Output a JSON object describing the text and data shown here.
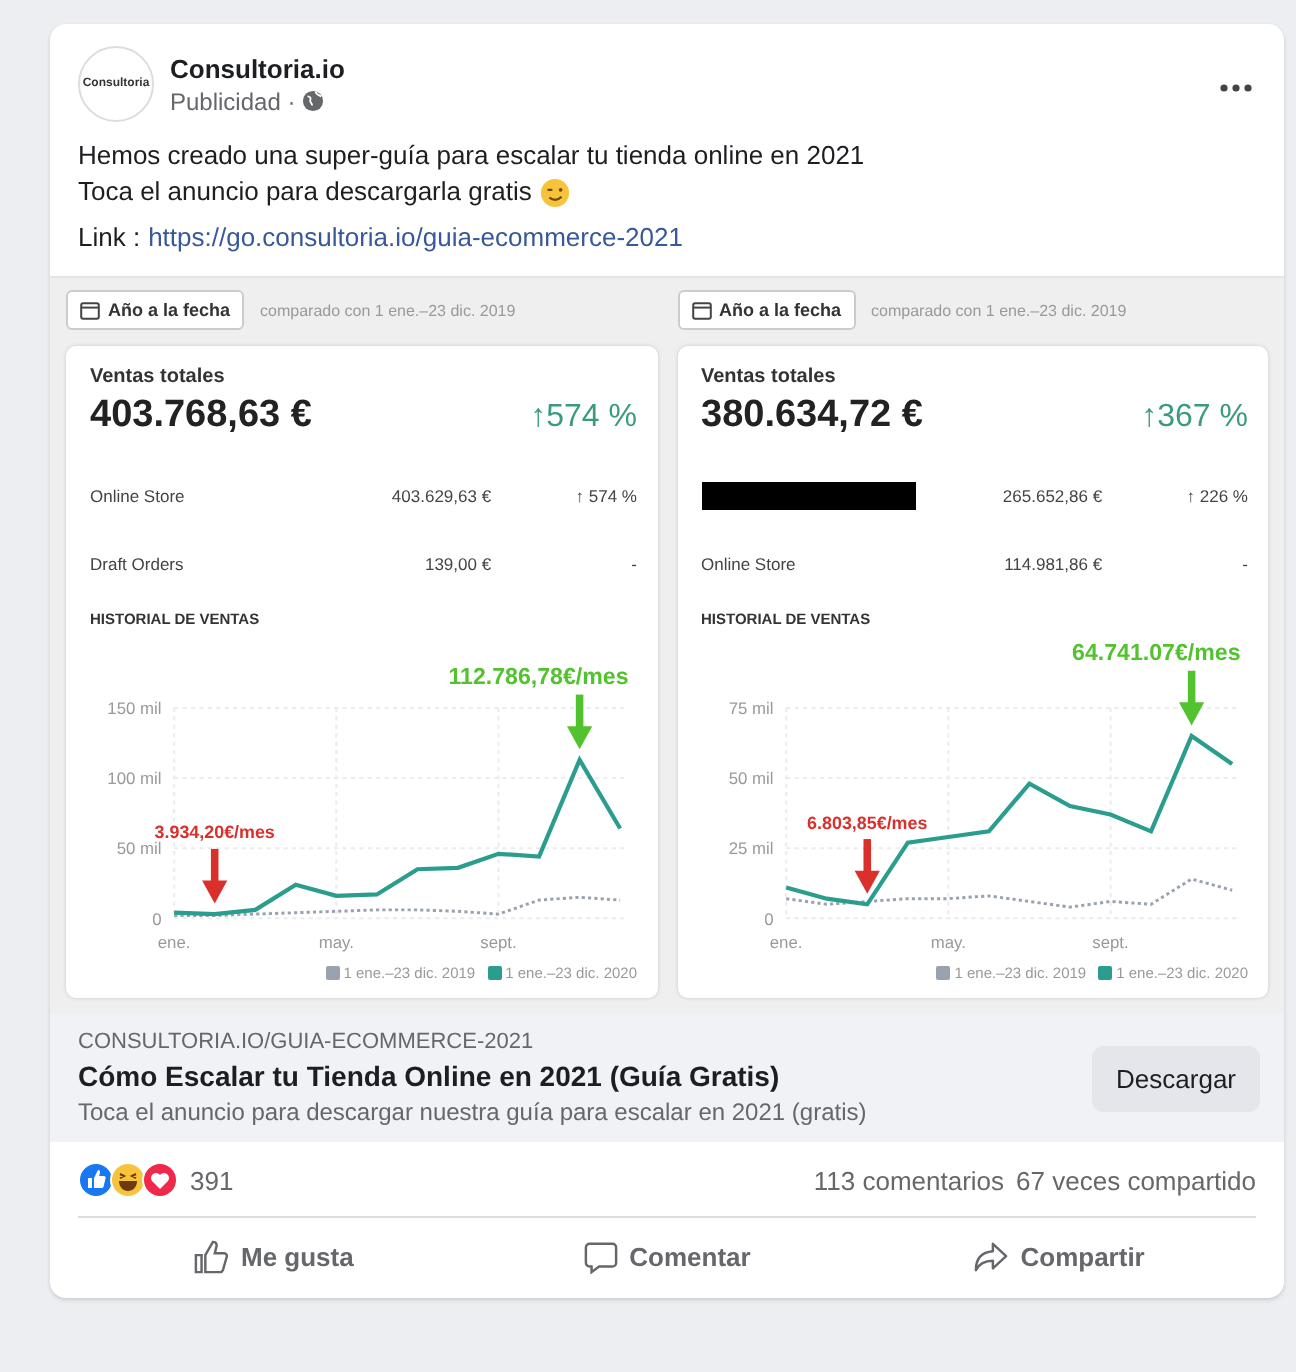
{
  "post": {
    "author": "Consultoria.io",
    "avatar_text": "Consultoria",
    "meta": "Publicidad ·",
    "lines": [
      "Hemos creado una super-guía para escalar tu tienda online en 2021",
      "Toca el anuncio para descargarla gratis"
    ],
    "link_label": "Link :",
    "link": "https://go.consultoria.io/guia-ecommerce-2021"
  },
  "dashboards": [
    {
      "range_button": "Año a la fecha",
      "compare": "comparado con 1 ene.–23 dic. 2019",
      "title": "Ventas totales",
      "total": "403.768,63 €",
      "change": "↑574 %",
      "rows": [
        {
          "label": "Online Store",
          "redacted": false,
          "amount": "403.629,63 €",
          "change": "↑ 574 %"
        },
        {
          "label": "Draft Orders",
          "redacted": false,
          "amount": "139,00 €",
          "change": "-"
        }
      ],
      "history_title": "HISTORIAL DE VENTAS",
      "chart_data": {
        "type": "line",
        "categories": [
          "ene.",
          null,
          null,
          null,
          "may.",
          null,
          null,
          null,
          "sept.",
          null,
          null,
          null
        ],
        "ylim": [
          0,
          150
        ],
        "grid": true,
        "yticks": [
          {
            "value": 0,
            "label": "0"
          },
          {
            "value": 50,
            "label": "50 mil"
          },
          {
            "value": 100,
            "label": "100 mil"
          },
          {
            "value": 150,
            "label": "150 mil"
          }
        ],
        "series": [
          {
            "name": "1 ene.–23 dic. 2019",
            "color": "#9aa3ad",
            "line_style": "dotted",
            "values": [
              2,
              2,
              3,
              4,
              5,
              6,
              6,
              5,
              3,
              13,
              15,
              13
            ]
          },
          {
            "name": "1 ene.–23 dic. 2020",
            "color": "#2a9d8f",
            "line_style": "solid",
            "values": [
              4,
              3,
              6,
              24,
              16,
              17,
              35,
              36,
              46,
              44,
              113,
              64
            ]
          }
        ],
        "annotations": [
          "3.934,20€/mes",
          "112.786,78€/mes"
        ]
      }
    },
    {
      "range_button": "Año a la fecha",
      "compare": "comparado con 1 ene.–23 dic. 2019",
      "title": "Ventas totales",
      "total": "380.634,72 €",
      "change": "↑367 %",
      "rows": [
        {
          "redacted": true,
          "amount": "265.652,86 €",
          "change": "↑ 226 %"
        },
        {
          "label": "Online Store",
          "redacted": false,
          "amount": "114.981,86 €",
          "change": "-"
        }
      ],
      "history_title": "HISTORIAL DE VENTAS",
      "chart_data": {
        "type": "line",
        "categories": [
          "ene.",
          null,
          null,
          null,
          "may.",
          null,
          null,
          null,
          "sept.",
          null,
          null,
          null
        ],
        "ylim": [
          0,
          75
        ],
        "grid": true,
        "yticks": [
          {
            "value": 0,
            "label": "0"
          },
          {
            "value": 25,
            "label": "25 mil"
          },
          {
            "value": 50,
            "label": "50 mil"
          },
          {
            "value": 75,
            "label": "75 mil"
          }
        ],
        "series": [
          {
            "name": "1 ene.–23 dic. 2019",
            "color": "#9aa3ad",
            "line_style": "dotted",
            "values": [
              7,
              5,
              6,
              7,
              7,
              8,
              6,
              4,
              6,
              5,
              14,
              10
            ]
          },
          {
            "name": "1 ene.–23 dic. 2020",
            "color": "#2a9d8f",
            "line_style": "solid",
            "values": [
              11,
              7,
              5,
              27,
              29,
              31,
              48,
              40,
              37,
              31,
              65,
              55
            ]
          }
        ],
        "annotations": [
          "6.803,85€/mes",
          "64.741.07€/mes"
        ]
      }
    }
  ],
  "preview": {
    "domain": "CONSULTORIA.IO/GUIA-ECOMMERCE-2021",
    "title": "Cómo Escalar tu Tienda Online en 2021 (Guía Gratis)",
    "description": "Toca el anuncio para descargar nuestra guía para escalar en 2021 (gratis)",
    "button": "Descargar"
  },
  "stats": {
    "reactions": "391",
    "comments": "113 comentarios",
    "shares": "67 veces compartido"
  },
  "actions": [
    {
      "kind": "like",
      "label": "Me gusta"
    },
    {
      "kind": "comment",
      "label": "Comentar"
    },
    {
      "kind": "share",
      "label": "Compartir"
    }
  ]
}
